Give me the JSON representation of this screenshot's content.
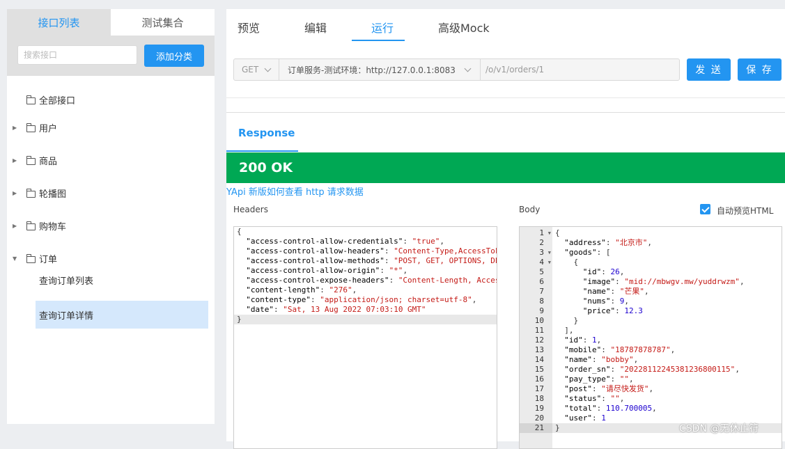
{
  "sidebar": {
    "tabs": [
      "接口列表",
      "测试集合"
    ],
    "search_placeholder": "搜索接口",
    "add_category_label": "添加分类",
    "tree": [
      {
        "label": "全部接口",
        "has_caret": false
      },
      {
        "label": "用户",
        "has_caret": true
      },
      {
        "label": "商品",
        "has_caret": true
      },
      {
        "label": "轮播图",
        "has_caret": true
      },
      {
        "label": "购物车",
        "has_caret": true
      },
      {
        "label": "订单",
        "has_caret": true,
        "expanded": true
      }
    ],
    "subitems": [
      {
        "label": "查询订单列表",
        "selected": false
      },
      {
        "label": "查询订单详情",
        "selected": true
      }
    ]
  },
  "tabs": [
    "预览",
    "编辑",
    "运行",
    "高级Mock"
  ],
  "active_tab": "运行",
  "request": {
    "method": "GET",
    "env": "订单服务-测试环境：http://127.0.0.1:8083",
    "path": "/o/v1/orders/1",
    "send_label": "发 送",
    "save_label": "保 存"
  },
  "response": {
    "tab_label": "Response",
    "status": "200 OK",
    "status_color": "#00a854",
    "link_text": "YApi 新版如何查看 http 请求数据",
    "headers_label": "Headers",
    "body_label": "Body",
    "preview_label": "自动预览HTML",
    "preview_checked": true
  },
  "headers_lines": [
    "{",
    "  \"access-control-allow-credentials\": \"true\",",
    "  \"access-control-allow-headers\": \"Content-Type,AccessTok",
    "  \"access-control-allow-methods\": \"POST, GET, OPTIONS, DE",
    "  \"access-control-allow-origin\": \"*\",",
    "  \"access-control-expose-headers\": \"Content-Length, Acces",
    "  \"content-length\": \"276\",",
    "  \"content-type\": \"application/json; charset=utf-8\",",
    "  \"date\": \"Sat, 13 Aug 2022 07:03:10 GMT\"",
    "}"
  ],
  "body_lines": [
    "{",
    "  \"address\": \"北京市\",",
    "  \"goods\": [",
    "    {",
    "      \"id\": 26,",
    "      \"image\": \"mid://mbwgv.mw/yuddrwzm\",",
    "      \"name\": \"芒果\",",
    "      \"nums\": 9,",
    "      \"price\": 12.3",
    "    }",
    "  ],",
    "  \"id\": 1,",
    "  \"mobile\": \"18787878787\",",
    "  \"name\": \"bobby\",",
    "  \"order_sn\": \"20228112245381236800115\",",
    "  \"pay_type\": \"\",",
    "  \"post\": \"请尽快发货\",",
    "  \"status\": \"\",",
    "  \"total\": 110.700005,",
    "  \"user\": 1",
    "}"
  ],
  "fold_lines": [
    1,
    3,
    4
  ],
  "watermark": "CSDN @无休止符"
}
